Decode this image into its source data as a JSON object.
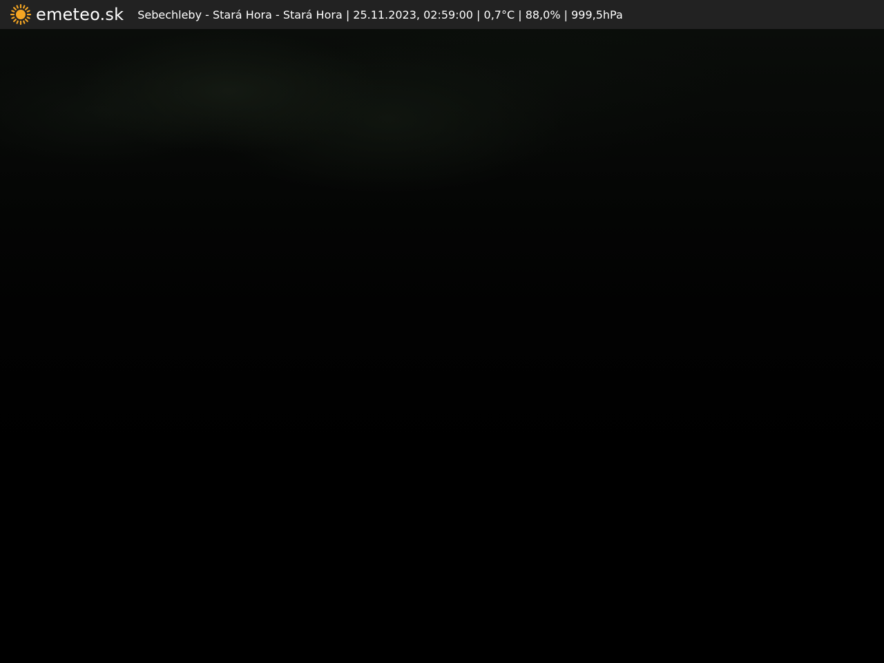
{
  "header": {
    "logo_icon": "sun-icon",
    "logo_text": "emeteo.sk",
    "caption": "Sebechleby - Stará Hora - Stará Hora | 25.11.2023, 02:59:00 | 0,7°C | 88,0% | 999,5hPa"
  },
  "colors": {
    "bar_background": "#222222",
    "sun_accent": "#f5a623",
    "text": "#ffffff"
  }
}
